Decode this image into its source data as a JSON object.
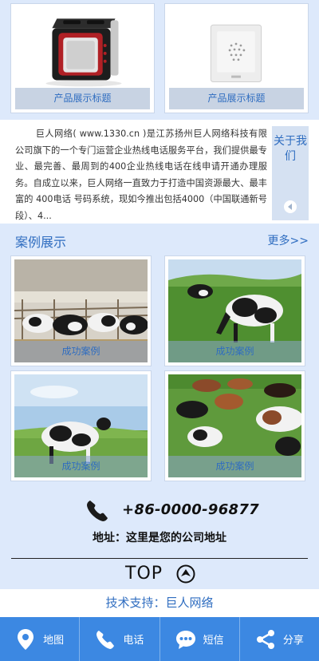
{
  "products": [
    {
      "caption": "产品展示标题",
      "image": "toaster-image"
    },
    {
      "caption": "产品展示标题",
      "image": "wall-speaker-image"
    }
  ],
  "intro": {
    "text": "巨人网络( www.1330.cn )是江苏扬州巨人网络科技有限公司旗下的一个专门运营企业热线电话服务平台，我们提供最专业、最完善、最周到的400企业热线电话在线申请开通办理服务。自成立以来，巨人网络一直致力于打造中国资源最大、最丰富的 400电话 号码系统，现如今推出包括4000（中国联通新号段）、4...",
    "side_label": "关于我们"
  },
  "cases": {
    "title": "案例展示",
    "more": "更多>>",
    "items": [
      {
        "caption": "成功案例",
        "image": "cows-barn-image"
      },
      {
        "caption": "成功案例",
        "image": "cow-grazing-image"
      },
      {
        "caption": "成功案例",
        "image": "cow-field-image"
      },
      {
        "caption": "成功案例",
        "image": "cattle-herd-image"
      }
    ]
  },
  "contact": {
    "phone": "+86-0000-96877",
    "address": "地址：这里是您的公司地址"
  },
  "top_button": {
    "label": "TOP"
  },
  "support": "技术支持：巨人网络",
  "bottom_nav": [
    {
      "label": "地图",
      "icon": "map-pin-icon"
    },
    {
      "label": "电话",
      "icon": "phone-icon"
    },
    {
      "label": "短信",
      "icon": "message-icon"
    },
    {
      "label": "分享",
      "icon": "share-icon"
    }
  ],
  "colors": {
    "accent": "#2f6dc0",
    "nav_bg": "#3c88e2",
    "page_bg": "#dde9fb"
  }
}
